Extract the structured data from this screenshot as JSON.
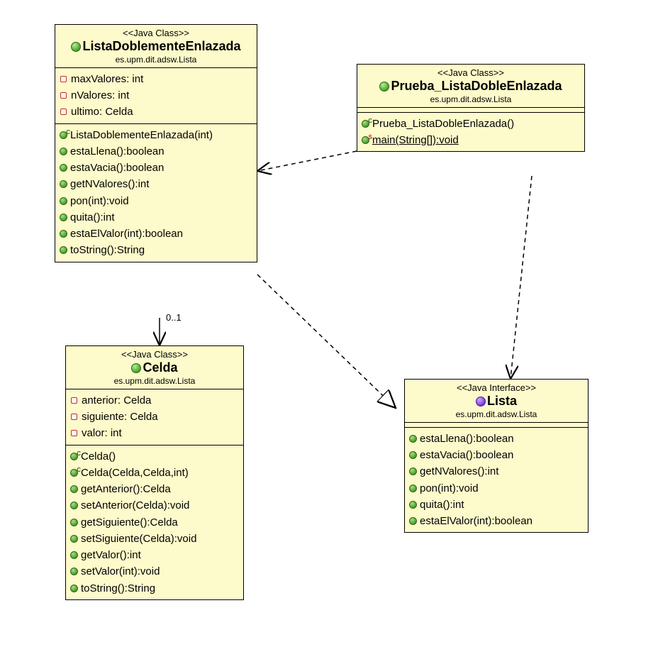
{
  "classes": {
    "lde": {
      "stereo": "<<Java Class>>",
      "name": "ListaDoblementeEnlazada",
      "pkg": "es.upm.dit.adsw.Lista",
      "fields": [
        "maxValores: int",
        "nValores: int",
        "ultimo: Celda"
      ],
      "methods": [
        {
          "t": "ListaDoblementeEnlazada(int)",
          "sup": "c"
        },
        {
          "t": "estaLlena():boolean"
        },
        {
          "t": "estaVacia():boolean"
        },
        {
          "t": "getNValores():int"
        },
        {
          "t": "pon(int):void"
        },
        {
          "t": "quita():int"
        },
        {
          "t": "estaElValor(int):boolean"
        },
        {
          "t": "toString():String"
        }
      ]
    },
    "prueba": {
      "stereo": "<<Java Class>>",
      "name": "Prueba_ListaDobleEnlazada",
      "pkg": "es.upm.dit.adsw.Lista",
      "methods": [
        {
          "t": "Prueba_ListaDobleEnlazada()",
          "sup": "c"
        },
        {
          "t": "main(String[]):void",
          "sup": "s",
          "underline": true
        }
      ]
    },
    "celda": {
      "stereo": "<<Java Class>>",
      "name": "Celda",
      "pkg": "es.upm.dit.adsw.Lista",
      "fields": [
        "anterior: Celda",
        "siguiente: Celda",
        "valor: int"
      ],
      "methods": [
        {
          "t": "Celda()",
          "sup": "c"
        },
        {
          "t": "Celda(Celda,Celda,int)",
          "sup": "c"
        },
        {
          "t": "getAnterior():Celda"
        },
        {
          "t": "setAnterior(Celda):void"
        },
        {
          "t": "getSiguiente():Celda"
        },
        {
          "t": "setSiguiente(Celda):void"
        },
        {
          "t": "getValor():int"
        },
        {
          "t": "setValor(int):void"
        },
        {
          "t": "toString():String"
        }
      ]
    },
    "lista": {
      "stereo": "<<Java Interface>>",
      "name": "Lista",
      "pkg": "es.upm.dit.adsw.Lista",
      "methods": [
        {
          "t": "estaLlena():boolean"
        },
        {
          "t": "estaVacia():boolean"
        },
        {
          "t": "getNValores():int"
        },
        {
          "t": "pon(int):void"
        },
        {
          "t": "quita():int"
        },
        {
          "t": "estaElValor(int):boolean"
        }
      ]
    }
  },
  "multiplicity": {
    "lde_celda": "0..1"
  }
}
